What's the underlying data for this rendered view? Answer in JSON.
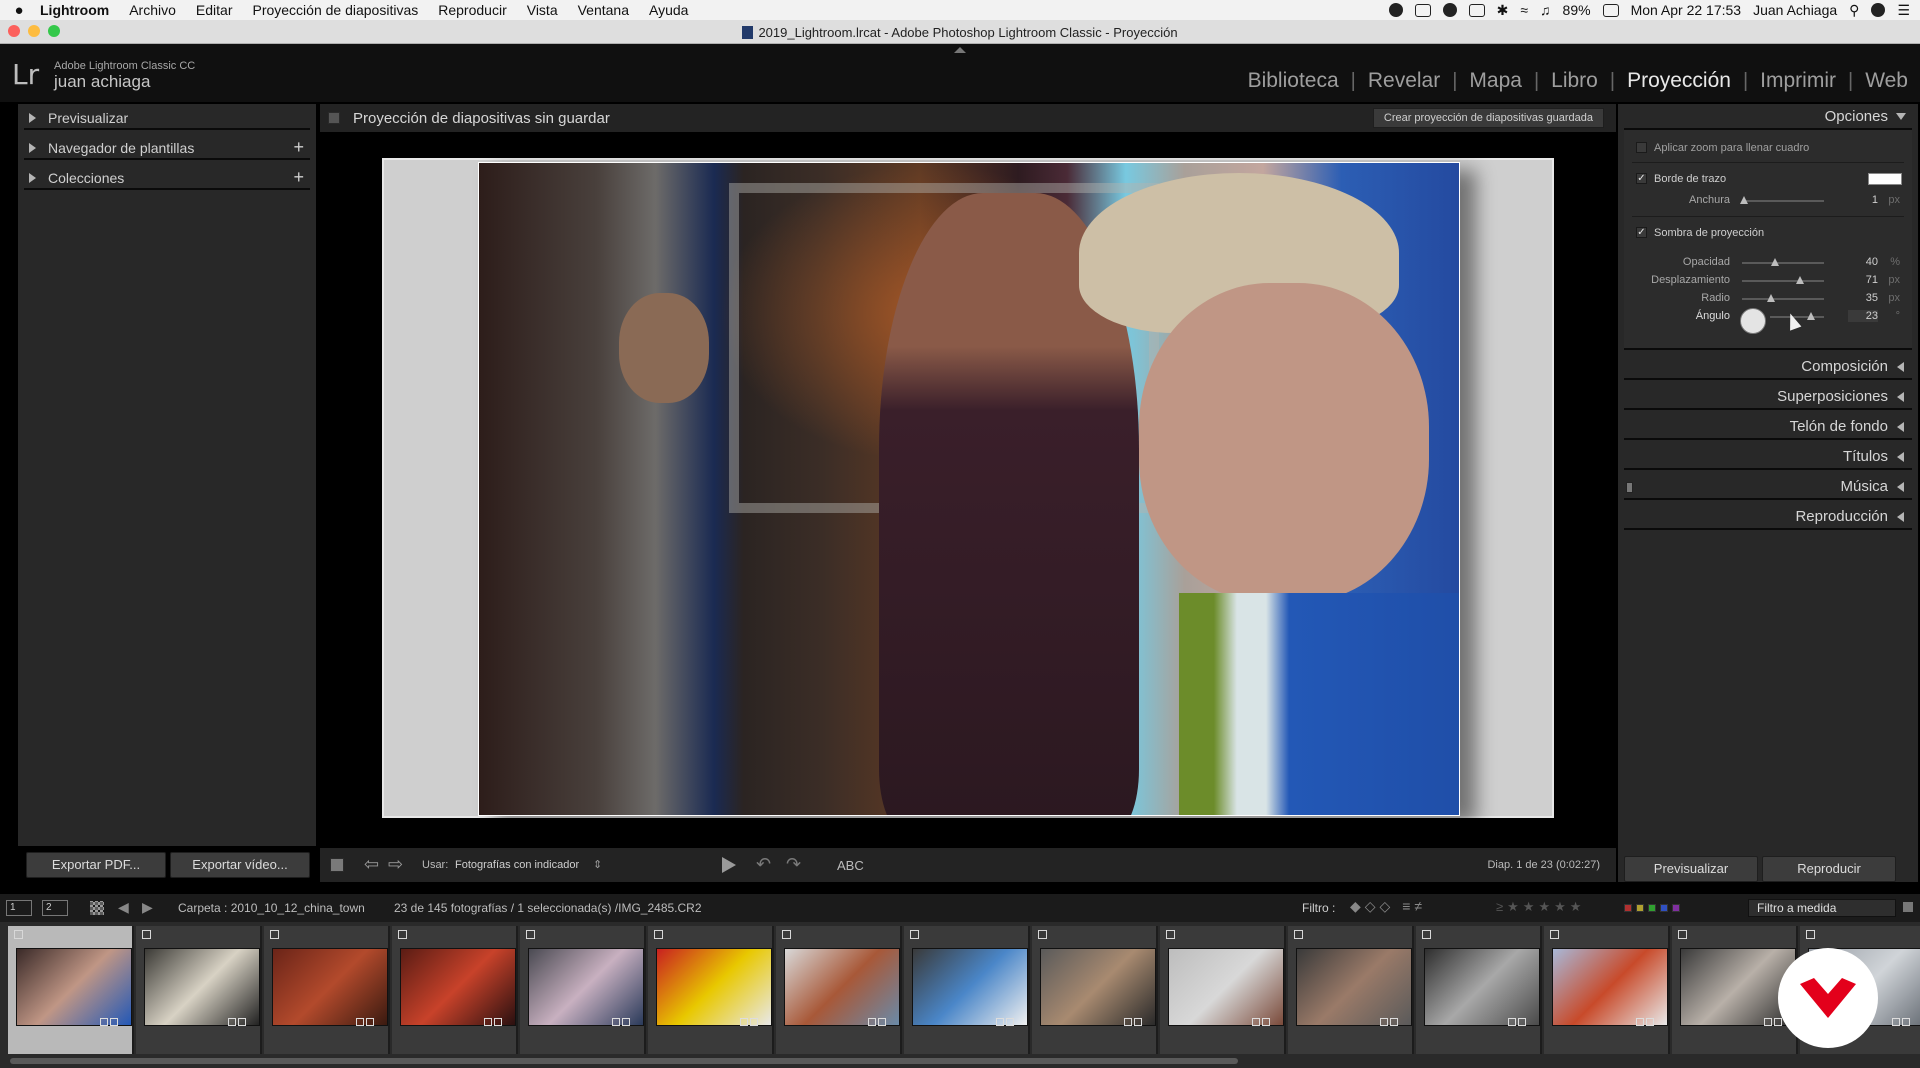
{
  "menubar": {
    "items": [
      "Lightroom",
      "Archivo",
      "Editar",
      "Proyección de diapositivas",
      "Reproducir",
      "Vista",
      "Ventana",
      "Ayuda"
    ],
    "battery": "89%",
    "datetime": "Mon Apr 22  17:53",
    "user": "Juan Achiaga"
  },
  "window": {
    "title": "2019_Lightroom.lrcat - Adobe Photoshop Lightroom Classic - Proyección"
  },
  "identity": {
    "logo": "Lr",
    "app_name": "Adobe Lightroom Classic CC",
    "user_name": "juan achiaga"
  },
  "modules": [
    "Biblioteca",
    "Revelar",
    "Mapa",
    "Libro",
    "Proyección",
    "Imprimir",
    "Web"
  ],
  "left_panel": {
    "sections": [
      {
        "label": "Previsualizar",
        "has_plus": false
      },
      {
        "label": "Navegador de plantillas",
        "has_plus": true
      },
      {
        "label": "Colecciones",
        "has_plus": true
      }
    ],
    "plus_label": "+",
    "export_pdf": "Exportar PDF...",
    "export_video": "Exportar vídeo..."
  },
  "center": {
    "title": "Proyección de diapositivas sin guardar",
    "save_button": "Crear proyección de diapositivas guardada"
  },
  "toolbar": {
    "use_label": "Usar:",
    "use_value": "Fotografías con indicador",
    "text_tool": "ABC",
    "counter": "Diap. 1 de 23 (0:02:27)"
  },
  "right_panel": {
    "options_title": "Opciones",
    "zoom_fill": {
      "label": "Aplicar zoom para llenar cuadro",
      "checked": false
    },
    "stroke_border": {
      "label": "Borde de trazo",
      "checked": true,
      "color": "#ffffff"
    },
    "width": {
      "label": "Anchura",
      "value": "1",
      "unit": "px",
      "fraction": 0.02
    },
    "drop_shadow": {
      "label": "Sombra de proyección",
      "checked": true
    },
    "shadow": [
      {
        "label": "Opacidad",
        "value": "40",
        "unit": "%",
        "fraction": 0.4
      },
      {
        "label": "Desplazamiento",
        "value": "71",
        "unit": "px",
        "fraction": 0.71
      },
      {
        "label": "Radio",
        "value": "35",
        "unit": "px",
        "fraction": 0.35
      },
      {
        "label": "Ángulo",
        "value": "23",
        "unit": "°",
        "fraction": 0.75
      }
    ],
    "sections": [
      "Composición",
      "Superposiciones",
      "Telón de fondo",
      "Títulos",
      "Música",
      "Reproducción"
    ],
    "preview_button": "Previsualizar",
    "play_button": "Reproducir"
  },
  "filmbar": {
    "screen1": "1",
    "screen2": "2",
    "folder": "Carpeta : 2010_10_12_china_town",
    "count": "23 de 145 fotografías / 1 seleccionada(s) /IMG_2485.CR2",
    "filter_label": "Filtro :",
    "custom_filter": "Filtro a medida"
  },
  "colors": {
    "accent_brand": "#e3001b",
    "panel_bg": "#282828",
    "label_colors": [
      "#b03030",
      "#b0a030",
      "#30a030",
      "#3050c0",
      "#8030a0"
    ]
  },
  "thumbnails": [
    {
      "name": "thumb-men-street",
      "selected": true
    },
    {
      "name": "thumb-market-stall",
      "selected": false
    },
    {
      "name": "thumb-roast-ducks",
      "selected": false
    },
    {
      "name": "thumb-butcher",
      "selected": false
    },
    {
      "name": "thumb-shop-street",
      "selected": false
    },
    {
      "name": "thumb-trading-sign",
      "selected": false
    },
    {
      "name": "thumb-storefront",
      "selected": false
    },
    {
      "name": "thumb-do-not-cross",
      "selected": false
    },
    {
      "name": "thumb-sidewalk",
      "selected": false
    },
    {
      "name": "thumb-man-sitting",
      "selected": false
    },
    {
      "name": "thumb-boy-portrait",
      "selected": false
    },
    {
      "name": "thumb-wall-figure",
      "selected": false
    },
    {
      "name": "thumb-street-corner",
      "selected": false
    },
    {
      "name": "thumb-alley",
      "selected": false
    },
    {
      "name": "thumb-partial",
      "selected": false
    }
  ]
}
